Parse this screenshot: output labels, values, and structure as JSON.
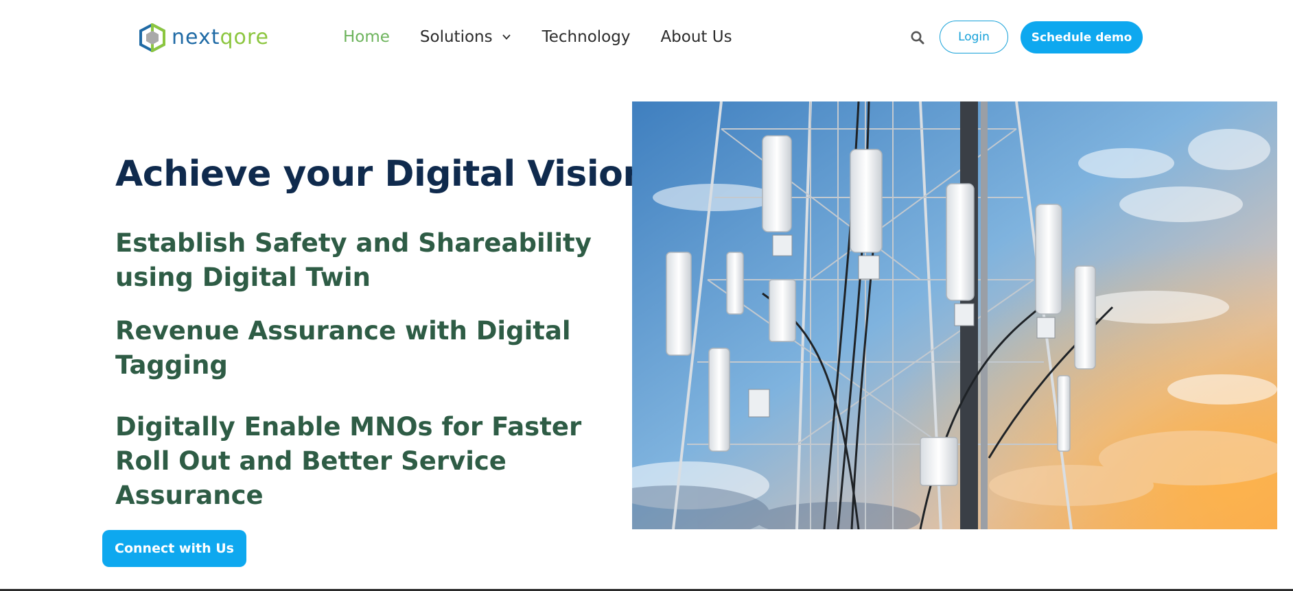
{
  "brand": {
    "name_part1": "next",
    "name_part2": "qore",
    "logo_icon": "hexagon-logo-icon"
  },
  "nav": {
    "items": [
      {
        "label": "Home",
        "active": true
      },
      {
        "label": "Solutions",
        "has_dropdown": true
      },
      {
        "label": "Technology"
      },
      {
        "label": "About Us"
      }
    ],
    "search_icon": "search-icon",
    "login_label": "Login",
    "demo_label": "Schedule demo"
  },
  "hero": {
    "title": "Achieve your Digital Vision",
    "taglines": [
      "Establish Safety and Shareability using Digital Twin",
      "Revenue Assurance with Digital Tagging",
      "Digitally Enable MNOs for Faster Roll Out and Better Service Assurance"
    ],
    "cta_label": "Connect with Us",
    "image_subject": "cell-tower-photo"
  },
  "colors": {
    "brand_blue": "#1f6aa5",
    "brand_green": "#8cc63f",
    "nav_active": "#6cb35b",
    "button_blue": "#0ea8ef",
    "title_navy": "#0f2a4d",
    "tagline_green": "#2e5c45"
  }
}
